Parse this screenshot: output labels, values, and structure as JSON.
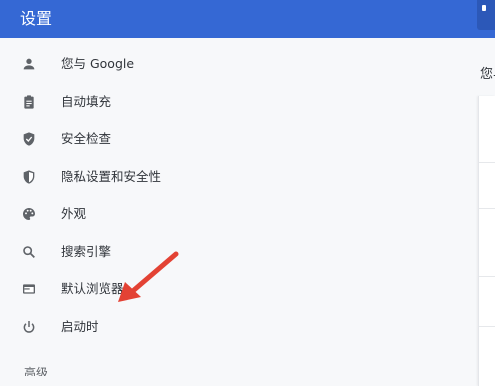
{
  "header": {
    "title": "设置"
  },
  "sidebar": {
    "items": [
      {
        "label": "您与 Google",
        "icon": "person-icon"
      },
      {
        "label": "自动填充",
        "icon": "clipboard-icon"
      },
      {
        "label": "安全检查",
        "icon": "shield-check-icon"
      },
      {
        "label": "隐私设置和安全性",
        "icon": "shield-half-icon"
      },
      {
        "label": "外观",
        "icon": "palette-icon"
      },
      {
        "label": "搜索引擎",
        "icon": "search-icon"
      },
      {
        "label": "默认浏览器",
        "icon": "browser-window-icon"
      },
      {
        "label": "启动时",
        "icon": "power-icon"
      }
    ],
    "section_stub": "高级"
  },
  "main": {
    "peek_text": "您与"
  },
  "colors": {
    "header": "#3568d4",
    "icon": "#5f6368",
    "arrow": "#e34234"
  }
}
